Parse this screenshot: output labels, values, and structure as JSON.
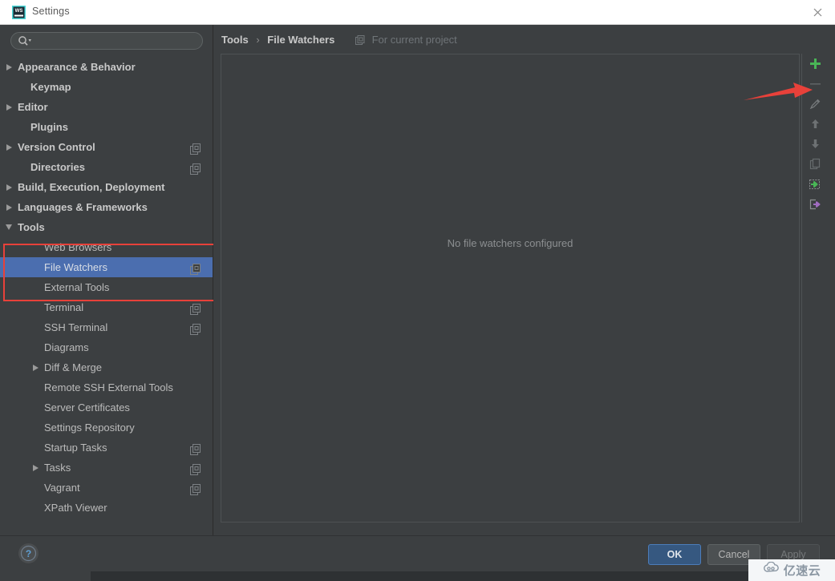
{
  "window": {
    "title": "Settings",
    "app_icon": "webstorm-icon",
    "close_icon": "close-icon"
  },
  "sidebar": {
    "search": {
      "value": "",
      "placeholder": "",
      "icon": "search-icon"
    },
    "items": [
      {
        "label": "Appearance & Behavior",
        "indent": 22,
        "arrow": "collapsed",
        "bold": true,
        "scope_icon": false,
        "selected": false
      },
      {
        "label": "Keymap",
        "indent": 38,
        "arrow": "none",
        "bold": true,
        "scope_icon": false,
        "selected": false
      },
      {
        "label": "Editor",
        "indent": 22,
        "arrow": "collapsed",
        "bold": true,
        "scope_icon": false,
        "selected": false
      },
      {
        "label": "Plugins",
        "indent": 38,
        "arrow": "none",
        "bold": true,
        "scope_icon": false,
        "selected": false
      },
      {
        "label": "Version Control",
        "indent": 22,
        "arrow": "collapsed",
        "bold": true,
        "scope_icon": true,
        "selected": false
      },
      {
        "label": "Directories",
        "indent": 38,
        "arrow": "none",
        "bold": true,
        "scope_icon": true,
        "selected": false
      },
      {
        "label": "Build, Execution, Deployment",
        "indent": 22,
        "arrow": "collapsed",
        "bold": true,
        "scope_icon": false,
        "selected": false
      },
      {
        "label": "Languages & Frameworks",
        "indent": 22,
        "arrow": "collapsed",
        "bold": true,
        "scope_icon": false,
        "selected": false
      },
      {
        "label": "Tools",
        "indent": 22,
        "arrow": "expanded",
        "bold": true,
        "scope_icon": false,
        "selected": false
      },
      {
        "label": "Web Browsers",
        "indent": 55,
        "arrow": "none",
        "bold": false,
        "scope_icon": false,
        "selected": false
      },
      {
        "label": "File Watchers",
        "indent": 55,
        "arrow": "none",
        "bold": false,
        "scope_icon": true,
        "selected": true
      },
      {
        "label": "External Tools",
        "indent": 55,
        "arrow": "none",
        "bold": false,
        "scope_icon": false,
        "selected": false
      },
      {
        "label": "Terminal",
        "indent": 55,
        "arrow": "none",
        "bold": false,
        "scope_icon": true,
        "selected": false
      },
      {
        "label": "SSH Terminal",
        "indent": 55,
        "arrow": "none",
        "bold": false,
        "scope_icon": true,
        "selected": false
      },
      {
        "label": "Diagrams",
        "indent": 55,
        "arrow": "none",
        "bold": false,
        "scope_icon": false,
        "selected": false
      },
      {
        "label": "Diff & Merge",
        "indent": 55,
        "arrow": "collapsed",
        "bold": false,
        "scope_icon": false,
        "selected": false
      },
      {
        "label": "Remote SSH External Tools",
        "indent": 55,
        "arrow": "none",
        "bold": false,
        "scope_icon": false,
        "selected": false
      },
      {
        "label": "Server Certificates",
        "indent": 55,
        "arrow": "none",
        "bold": false,
        "scope_icon": false,
        "selected": false
      },
      {
        "label": "Settings Repository",
        "indent": 55,
        "arrow": "none",
        "bold": false,
        "scope_icon": false,
        "selected": false
      },
      {
        "label": "Startup Tasks",
        "indent": 55,
        "arrow": "none",
        "bold": false,
        "scope_icon": true,
        "selected": false
      },
      {
        "label": "Tasks",
        "indent": 55,
        "arrow": "collapsed",
        "bold": false,
        "scope_icon": true,
        "selected": false
      },
      {
        "label": "Vagrant",
        "indent": 55,
        "arrow": "none",
        "bold": false,
        "scope_icon": true,
        "selected": false
      },
      {
        "label": "XPath Viewer",
        "indent": 55,
        "arrow": "none",
        "bold": false,
        "scope_icon": false,
        "selected": false
      }
    ]
  },
  "main": {
    "breadcrumb": {
      "parent": "Tools",
      "separator": "›",
      "current": "File Watchers",
      "scope_note": "For current project",
      "scope_icon": "project-scope-icon"
    },
    "empty_message": "No file watchers configured",
    "toolbar": [
      {
        "name": "add-button",
        "icon": "plus-icon",
        "enabled": true
      },
      {
        "name": "remove-button",
        "icon": "minus-icon",
        "enabled": false
      },
      {
        "name": "edit-button",
        "icon": "pencil-icon",
        "enabled": false
      },
      {
        "name": "move-up-button",
        "icon": "arrow-up-icon",
        "enabled": false
      },
      {
        "name": "move-down-button",
        "icon": "arrow-down-icon",
        "enabled": false
      },
      {
        "name": "copy-button",
        "icon": "copy-icon",
        "enabled": false
      },
      {
        "name": "import-button",
        "icon": "import-icon",
        "enabled": true
      },
      {
        "name": "export-button",
        "icon": "export-icon",
        "enabled": true
      }
    ]
  },
  "footer": {
    "help_label": "?",
    "ok_label": "OK",
    "cancel_label": "Cancel",
    "apply_label": "Apply"
  },
  "annotations": {
    "arrow_color": "#e8413a",
    "rect_color": "#e8413a"
  },
  "watermark": {
    "text": "亿速云",
    "icon": "cloud-logo-icon"
  },
  "colors": {
    "background": "#3c3f41",
    "selection": "#4b6eaf",
    "accent_green": "#4caf50",
    "accent_blue": "#365880",
    "text": "#bbbbbb"
  }
}
